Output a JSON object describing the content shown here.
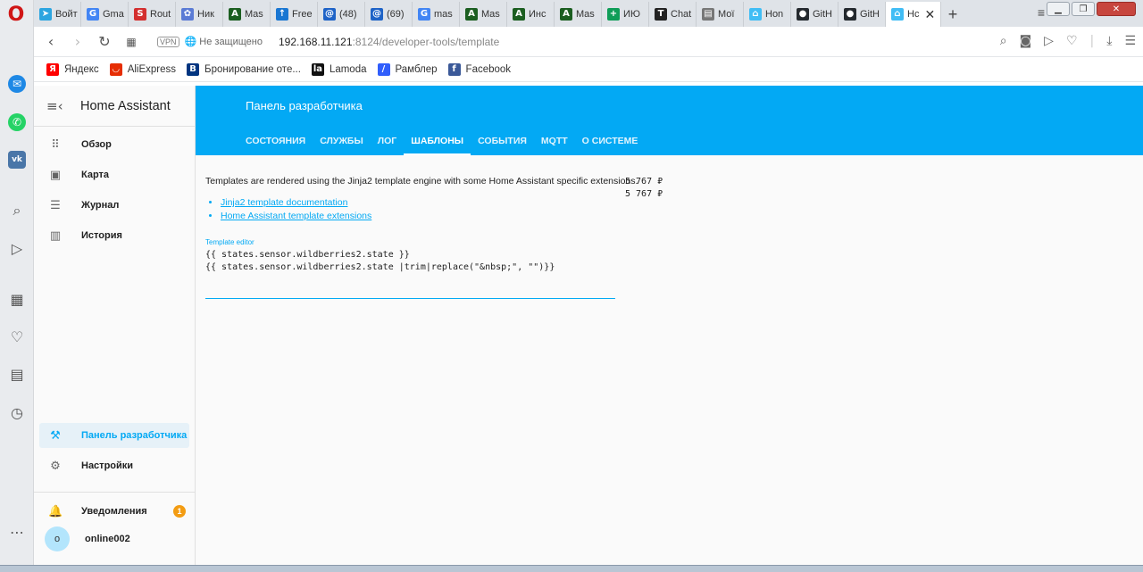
{
  "browser": {
    "tabs": [
      {
        "label": "Войт",
        "icon": "telegram-icon",
        "color": "#2ca5e0"
      },
      {
        "label": "Gma",
        "icon": "google-icon",
        "color": "#4285f4"
      },
      {
        "label": "Rout",
        "icon": "s-icon",
        "color": "#d32f2f"
      },
      {
        "label": "Ник",
        "icon": "flower-icon",
        "color": "#5b7bd5"
      },
      {
        "label": "Mas",
        "icon": "a-icon",
        "color": "#1b5e20"
      },
      {
        "label": "Free",
        "icon": "upload-icon",
        "color": "#1976d2"
      },
      {
        "label": "(48)",
        "icon": "mail-at-icon",
        "color": "#1e63c7"
      },
      {
        "label": "(69)",
        "icon": "mail-at-icon",
        "color": "#1e63c7"
      },
      {
        "label": "mas",
        "icon": "google-icon",
        "color": "#4285f4"
      },
      {
        "label": "Mas",
        "icon": "a-icon",
        "color": "#1b5e20"
      },
      {
        "label": "Инс",
        "icon": "a-icon",
        "color": "#1b5e20"
      },
      {
        "label": "Mas",
        "icon": "a-icon",
        "color": "#1b5e20"
      },
      {
        "label": "ИЮ",
        "icon": "plus-icon",
        "color": "#0f9d58"
      },
      {
        "label": "Chat",
        "icon": "t-icon",
        "color": "#222222"
      },
      {
        "label": "Мої",
        "icon": "document-icon",
        "color": "#777777"
      },
      {
        "label": "Hon",
        "icon": "home-assistant-icon",
        "color": "#41bdf5"
      },
      {
        "label": "GitH",
        "icon": "github-icon",
        "color": "#24292e"
      },
      {
        "label": "GitH",
        "icon": "github-icon",
        "color": "#24292e"
      },
      {
        "label": "Hc",
        "icon": "home-assistant-icon",
        "color": "#41bdf5"
      }
    ],
    "address": {
      "vpn": "VPN",
      "insecure": "Не защищено",
      "host": "192.168.11.121",
      "rest": ":8124/developer-tools/template"
    },
    "bookmarks": [
      {
        "label": "Яндекс",
        "icon": "yandex-icon",
        "color": "#ff0000",
        "glyph": "Я"
      },
      {
        "label": "AliExpress",
        "icon": "aliexpress-icon",
        "color": "#e62e04",
        "glyph": "◡"
      },
      {
        "label": "Бронирование оте...",
        "icon": "booking-icon",
        "color": "#003580",
        "glyph": "B"
      },
      {
        "label": "Lamoda",
        "icon": "lamoda-icon",
        "color": "#111111",
        "glyph": "la"
      },
      {
        "label": "Рамблер",
        "icon": "rambler-icon",
        "color": "#315efb",
        "glyph": "/"
      },
      {
        "label": "Facebook",
        "icon": "facebook-icon",
        "color": "#3b5998",
        "glyph": "f"
      }
    ]
  },
  "sidebar": {
    "title": "Home Assistant",
    "items": [
      {
        "label": "Обзор",
        "icon": "grid-icon"
      },
      {
        "label": "Карта",
        "icon": "map-icon"
      },
      {
        "label": "Журнал",
        "icon": "list-icon"
      },
      {
        "label": "История",
        "icon": "chart-icon"
      },
      {
        "label": "Панель разработчика",
        "icon": "hammer-icon"
      },
      {
        "label": "Настройки",
        "icon": "gear-icon"
      },
      {
        "label": "Уведомления",
        "icon": "bell-icon"
      },
      {
        "label": "online002",
        "icon": "avatar"
      }
    ],
    "notification_count": "1",
    "avatar_letter": "o"
  },
  "header": {
    "title": "Панель разработчика",
    "tabs": [
      "СОСТОЯНИЯ",
      "СЛУЖБЫ",
      "ЛОГ",
      "ШАБЛОНЫ",
      "СОБЫТИЯ",
      "MQTT",
      "О СИСТЕМЕ"
    ],
    "active_tab": "ШАБЛОНЫ"
  },
  "content": {
    "intro": "Templates are rendered using the Jinja2 template engine with some Home Assistant specific extensions.",
    "links": [
      "Jinja2 template documentation",
      "Home Assistant template extensions"
    ],
    "editor_label": "Template editor",
    "editor_line1": "{{ states.sensor.wildberries2.state }}",
    "editor_line2": "{{ states.sensor.wildberries2.state |trim|replace(\"&nbsp;\", \"\")}}",
    "result_line1": "5 767 ₽",
    "result_line2": "5 767 ₽"
  },
  "colors": {
    "accent": "#03a9f4",
    "opera_red": "#d01616",
    "badge": "#f39c12"
  }
}
